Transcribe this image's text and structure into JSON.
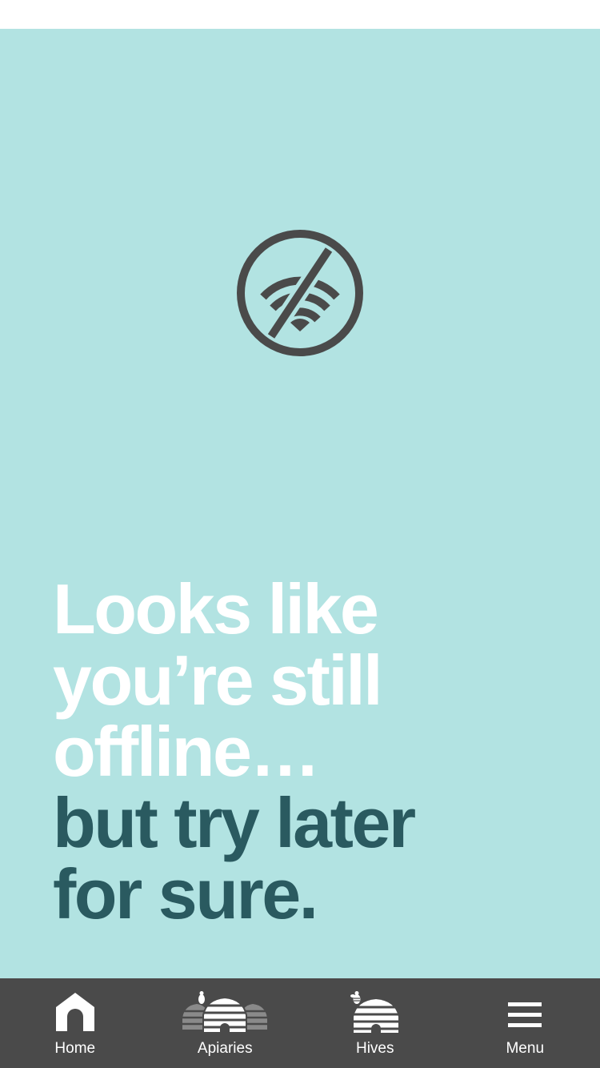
{
  "headline": {
    "line1": "Looks like",
    "line2": "you’re still",
    "line3": "offline…",
    "line4": "but try later",
    "line5": "for sure."
  },
  "tabs": [
    {
      "label": "Home",
      "icon": "home-icon"
    },
    {
      "label": "Apiaries",
      "icon": "apiaries-icon"
    },
    {
      "label": "Hives",
      "icon": "hive-icon"
    },
    {
      "label": "Menu",
      "icon": "hamburger-menu-icon"
    }
  ],
  "colors": {
    "background": "#b2e3e2",
    "headline_light": "#ffffff",
    "headline_dark": "#2a5a60",
    "icon": "#4a4a4a",
    "tab_bar": "#4a4a4a"
  }
}
